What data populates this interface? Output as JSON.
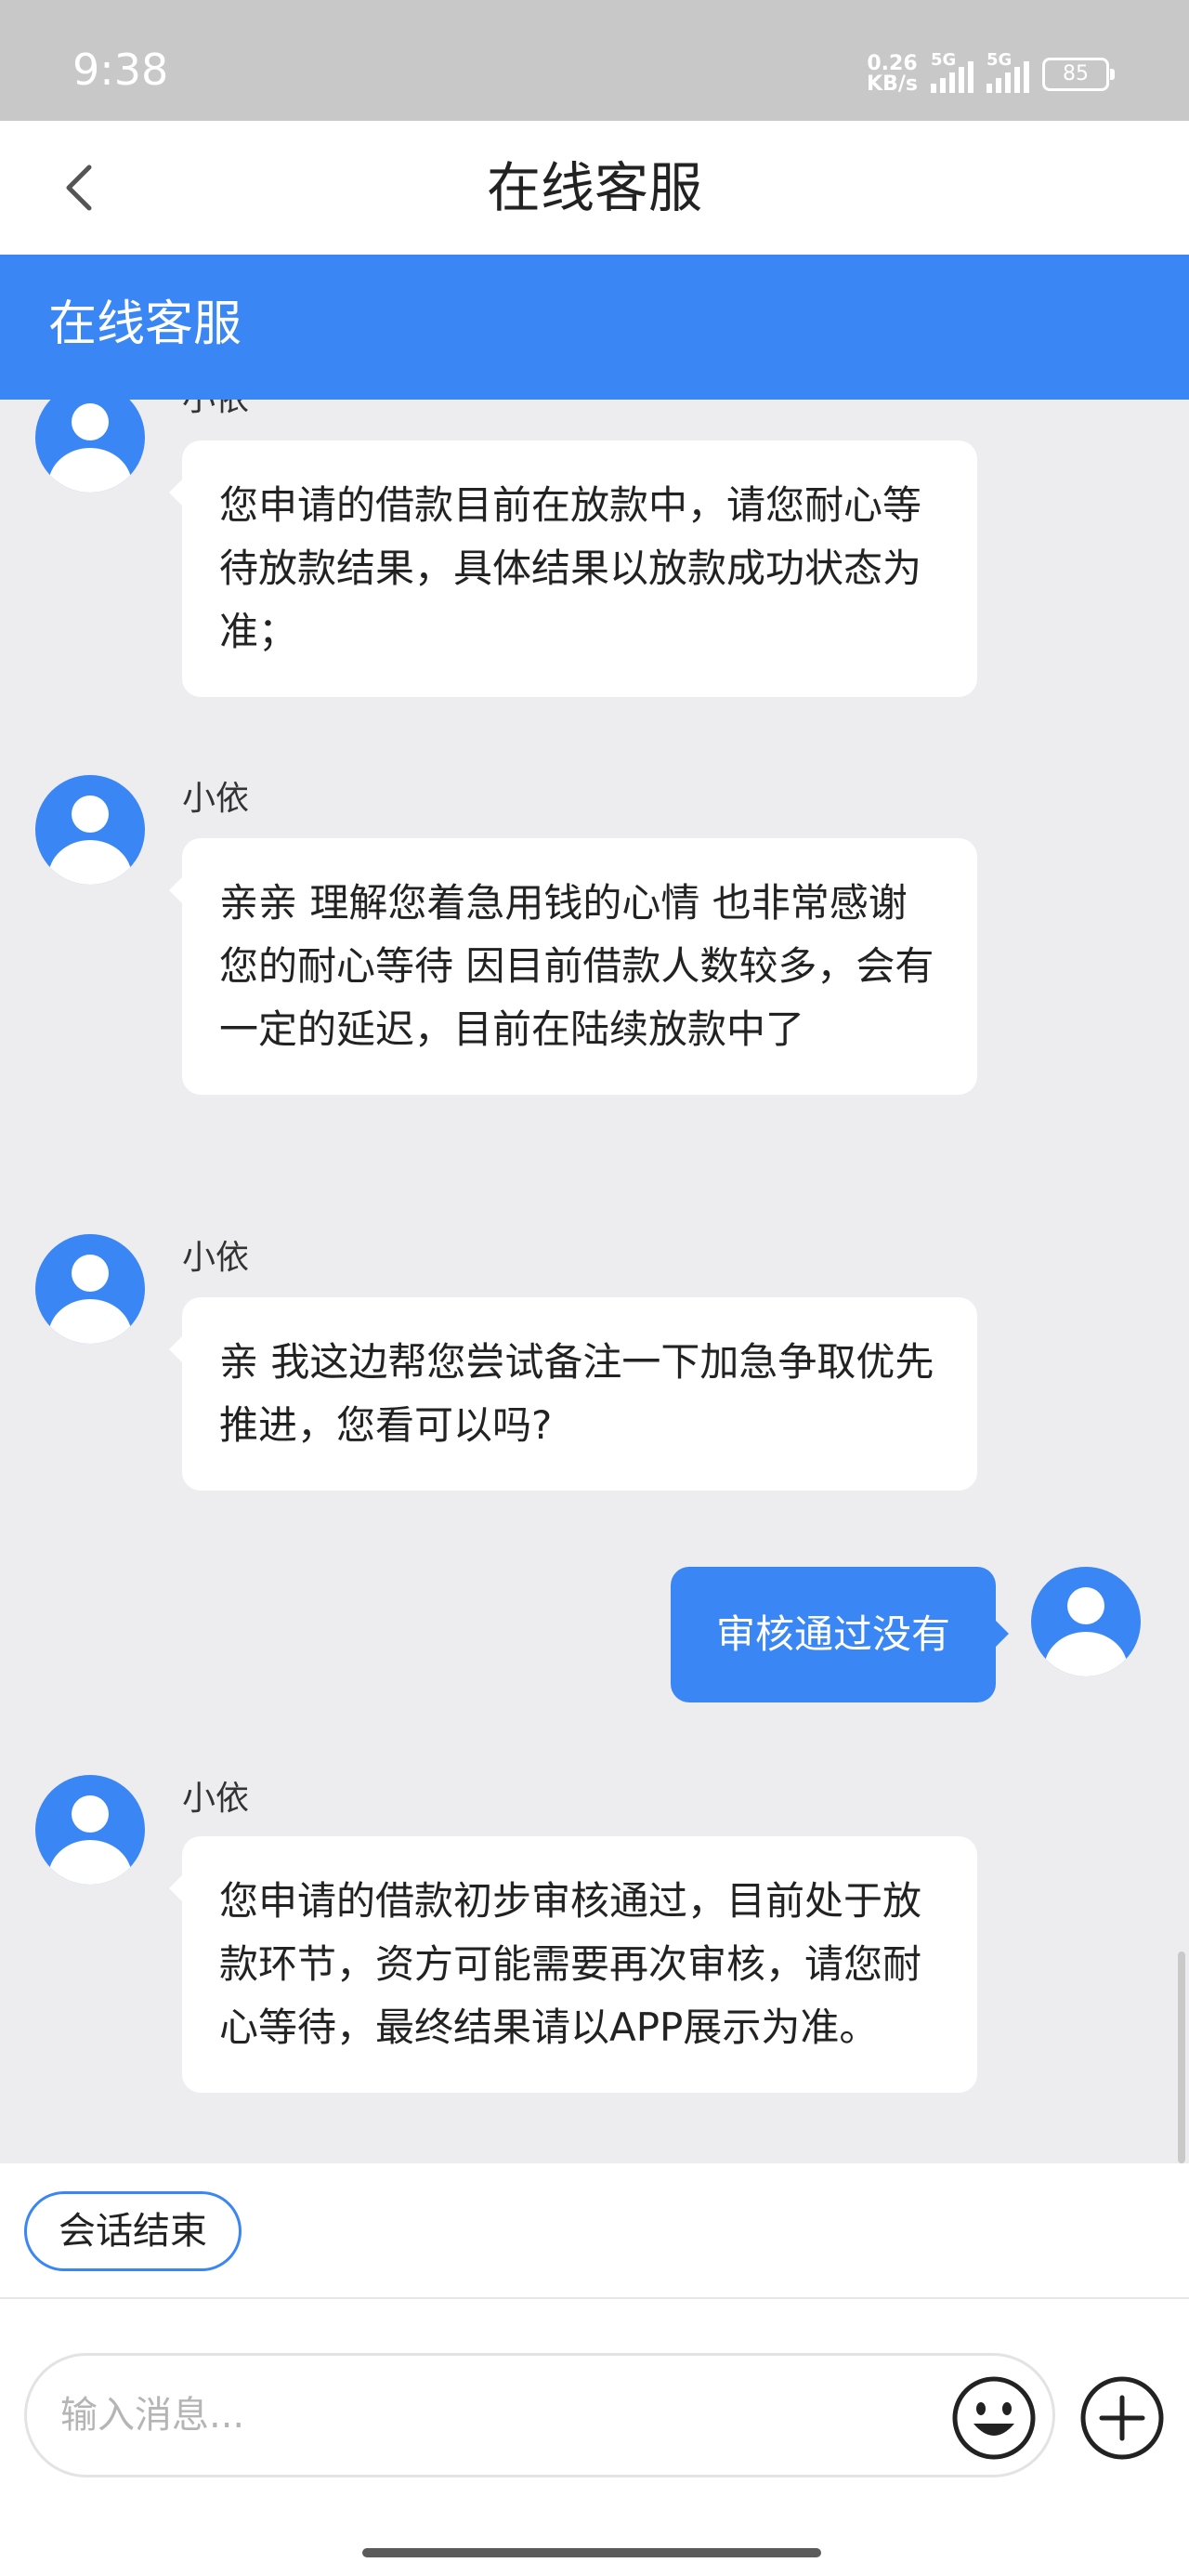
{
  "status_bar": {
    "time": "9:38",
    "net_speed_value": "0.26",
    "net_speed_unit": "KB/s",
    "sim1_tag": "5G",
    "sim2_tag": "5G",
    "battery": "85"
  },
  "header": {
    "title": "在线客服",
    "back_icon": "chevron-left-icon"
  },
  "banner": {
    "title": "在线客服"
  },
  "messages": [
    {
      "from": "agent",
      "sender": "小依",
      "text": "您申请的借款目前在放款中，请您耐心等待放款结果，具体结果以放款成功状态为准；"
    },
    {
      "from": "agent",
      "sender": "小依",
      "text": "亲亲 理解您着急用钱的心情 也非常感谢您的耐心等待 因目前借款人数较多，会有一定的延迟，目前在陆续放款中了"
    },
    {
      "from": "agent",
      "sender": "小依",
      "text": "亲 我这边帮您尝试备注一下加急争取优先推进，您看可以吗?"
    },
    {
      "from": "user",
      "text": "审核通过没有"
    },
    {
      "from": "agent",
      "sender": "小依",
      "text": "您申请的借款初步审核通过，目前处于放款环节，资方可能需要再次审核，请您耐心等待，最终结果请以APP展示为准。"
    }
  ],
  "quick_actions": {
    "end_chat": "会话结束"
  },
  "composer": {
    "placeholder": "输入消息...",
    "value": "",
    "emoji_icon": "emoji-icon",
    "plus_icon": "plus-icon"
  },
  "colors": {
    "accent": "#3a86f5",
    "background": "#ededef",
    "status_bar": "#c8c8c8"
  }
}
